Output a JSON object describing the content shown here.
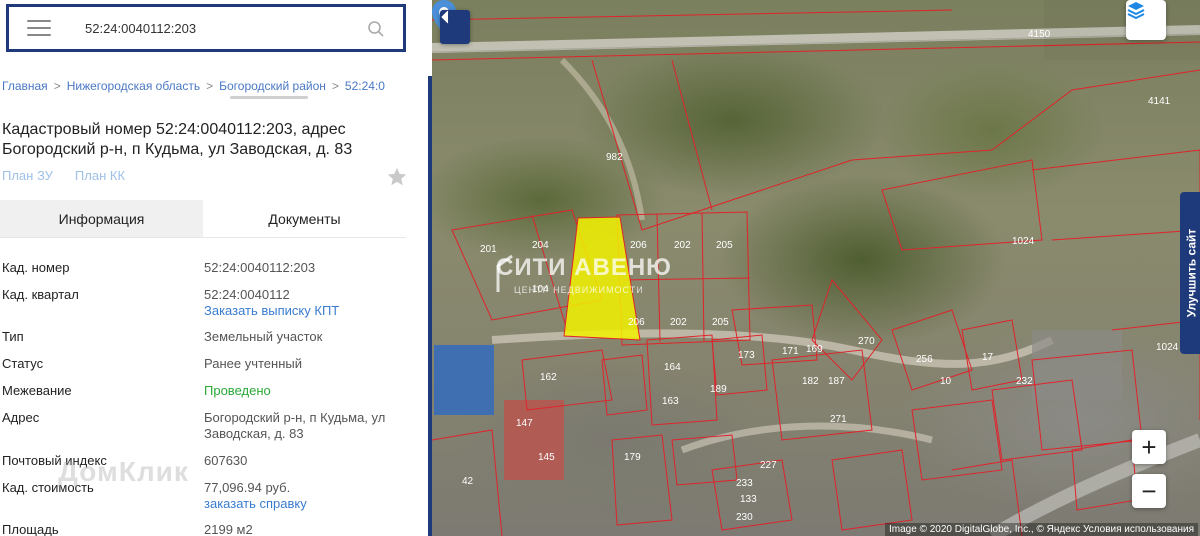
{
  "search": {
    "value": "52:24:0040112:203"
  },
  "breadcrumb": [
    "Главная",
    "Нижегородская область",
    "Богородский район",
    "52:24:0"
  ],
  "title": "Кадастровый номер 52:24:0040112:203, адрес Богородский р-н, п Кудьма, ул Заводская, д. 83",
  "plan_links": [
    "План ЗУ",
    "План КК"
  ],
  "tabs": [
    {
      "label": "Информация",
      "active": true
    },
    {
      "label": "Документы",
      "active": false
    }
  ],
  "info": {
    "cad_number": {
      "label": "Кад. номер",
      "value": "52:24:0040112:203"
    },
    "cad_quarter": {
      "label": "Кад. квартал",
      "value": "52:24:0040112",
      "link": "Заказать выписку КПТ"
    },
    "type": {
      "label": "Тип",
      "value": "Земельный участок"
    },
    "status": {
      "label": "Статус",
      "value": "Ранее учтенный"
    },
    "survey": {
      "label": "Межевание",
      "value": "Проведено"
    },
    "address": {
      "label": "Адрес",
      "value": "Богородский р-н, п Кудьма, ул Заводская, д. 83"
    },
    "postcode": {
      "label": "Почтовый индекс",
      "value": "607630"
    },
    "cad_value": {
      "label": "Кад. стоимость",
      "value": "77,096.94 руб.",
      "link": "заказать справку"
    },
    "area": {
      "label": "Площадь",
      "value": "2199 м2"
    }
  },
  "watermark": "ДомКлик",
  "map": {
    "improve_site": "Улучшить сайт",
    "zoom_in": "+",
    "zoom_out": "−",
    "copyright": "Image © 2020 DigitalGlobe, Inc., © Яндекс Условия использования",
    "logo": "СИТИ АВЕНЮ",
    "logo_sub": "ЦЕНТР НЕДВИЖИМОСТИ",
    "parcel_labels": [
      "4150",
      "4141",
      "982",
      "1024",
      "201",
      "204",
      "206",
      "202",
      "205",
      "104",
      "206",
      "202",
      "205",
      "270",
      "256",
      "17",
      "10",
      "1024",
      "162",
      "164",
      "163",
      "189",
      "173",
      "171",
      "169",
      "182",
      "187",
      "147",
      "145",
      "133",
      "179",
      "271",
      "227",
      "233",
      "42",
      "230",
      "232"
    ],
    "colors": {
      "parcel_stroke": "#e0232a",
      "highlight": "#f2f200",
      "accent": "#1f3a7a"
    }
  }
}
